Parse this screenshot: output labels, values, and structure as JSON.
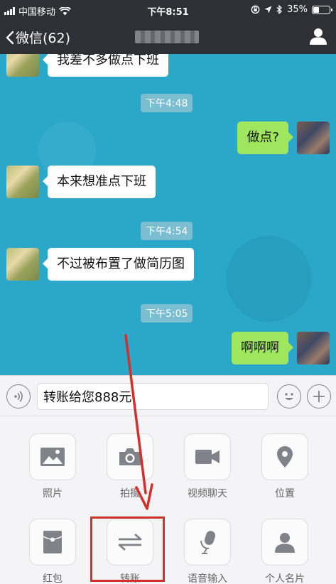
{
  "status_bar": {
    "carrier": "中国移动",
    "time": "下午8:51",
    "battery_text": "35%",
    "battery_level": 0.35
  },
  "nav": {
    "back_label": "微信(62)",
    "contact_name": ""
  },
  "chat": {
    "messages": [
      {
        "side": "left",
        "text": "我差不多做点下班"
      },
      {
        "type": "time",
        "text": "下午4:48"
      },
      {
        "side": "right",
        "text": "做点?"
      },
      {
        "side": "left",
        "text": "本来想准点下班"
      },
      {
        "type": "time",
        "text": "下午4:54"
      },
      {
        "side": "left",
        "text": "不过被布置了做简历图"
      },
      {
        "type": "time",
        "text": "下午5:05"
      },
      {
        "side": "right",
        "text": "啊啊啊"
      }
    ]
  },
  "input_bar": {
    "value": "转账给您888元"
  },
  "tools": [
    {
      "label": "照片",
      "icon": "photo-icon"
    },
    {
      "label": "拍摄",
      "icon": "camera-icon"
    },
    {
      "label": "视频聊天",
      "icon": "video-icon"
    },
    {
      "label": "位置",
      "icon": "location-icon"
    },
    {
      "label": "红包",
      "icon": "red-packet-icon"
    },
    {
      "label": "转账",
      "icon": "transfer-icon"
    },
    {
      "label": "语音输入",
      "icon": "microphone-icon"
    },
    {
      "label": "个人名片",
      "icon": "contact-card-icon"
    }
  ],
  "colors": {
    "nav_bg": "#2f3035",
    "chat_bg": "#2aa7c9",
    "bubble_right": "#9fe75e",
    "annotation": "#d2302a"
  }
}
